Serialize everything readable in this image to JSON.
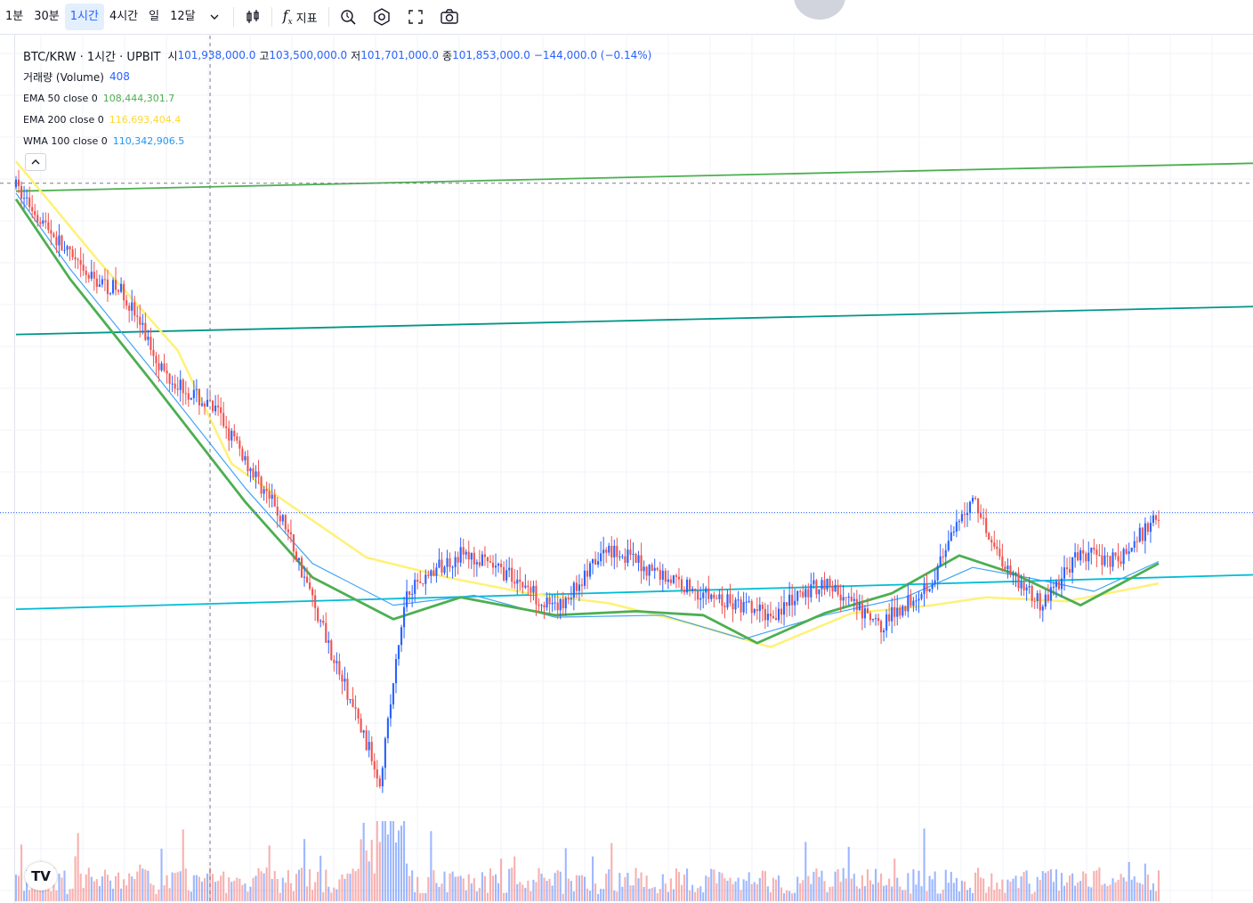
{
  "toolbar": {
    "intervals": [
      {
        "label": "1분",
        "active": false
      },
      {
        "label": "30분",
        "active": false
      },
      {
        "label": "1시간",
        "active": true
      },
      {
        "label": "4시간",
        "active": false
      },
      {
        "label": "일",
        "active": false
      },
      {
        "label": "12달",
        "active": false
      }
    ],
    "indicators_label": "지표",
    "icons": [
      "chevron-down-icon",
      "candle-icon",
      "fx-icon",
      "alert-icon",
      "settings-icon",
      "fullscreen-icon",
      "camera-icon"
    ]
  },
  "legend": {
    "title": "BTC/KRW · 1시간 · UPBIT",
    "open_label": "시",
    "open": "101,938,000.0",
    "high_label": "고",
    "high": "103,500,000.0",
    "low_label": "저",
    "low": "101,701,000.0",
    "close_label": "종",
    "close": "101,853,000.0",
    "change": "−144,000.0 (−0.14%)",
    "volume": {
      "name": "거래량 (Volume)",
      "value": "408",
      "color": "#2962ff"
    },
    "ema50": {
      "name": "EMA 50 close 0",
      "value": "108,444,301.7",
      "color": "#4caf50"
    },
    "ema200": {
      "name": "EMA 200 close 0",
      "value": "116,693,404.4",
      "color": "#ffeb3b"
    },
    "wma100": {
      "name": "WMA 100 close 0",
      "value": "110,342,906.5",
      "color": "#2196f3"
    }
  },
  "colors": {
    "up": "#2962ff",
    "down": "#ef5350",
    "ema50": "#4caf50",
    "ema200": "#fff176",
    "wma100": "#42a5f5",
    "trend_top": "#4caf50",
    "trend_mid": "#009688",
    "trend_low": "#00bcd4"
  },
  "chart_data": {
    "type": "candlestick",
    "symbol": "BTC/KRW",
    "interval": "1시간",
    "exchange": "UPBIT",
    "bars": 425,
    "ylim": [
      86000000,
      120000000
    ],
    "close_path": [
      [
        0,
        118200000
      ],
      [
        10,
        116500000
      ],
      [
        25,
        113800000
      ],
      [
        40,
        112900000
      ],
      [
        55,
        108900000
      ],
      [
        75,
        106800000
      ],
      [
        100,
        101200000
      ],
      [
        120,
        93800000
      ],
      [
        135,
        88500000
      ],
      [
        145,
        98000000
      ],
      [
        165,
        99800000
      ],
      [
        185,
        98600000
      ],
      [
        200,
        96900000
      ],
      [
        220,
        100100000
      ],
      [
        240,
        98700000
      ],
      [
        260,
        97500000
      ],
      [
        280,
        96700000
      ],
      [
        300,
        98400000
      ],
      [
        320,
        96100000
      ],
      [
        340,
        98500000
      ],
      [
        355,
        102700000
      ],
      [
        365,
        99600000
      ],
      [
        380,
        97200000
      ],
      [
        395,
        99800000
      ],
      [
        410,
        99500000
      ],
      [
        424,
        101853000
      ]
    ],
    "ema50_path": [
      [
        0,
        117600000
      ],
      [
        20,
        113600000
      ],
      [
        50,
        108500000
      ],
      [
        85,
        102400000
      ],
      [
        110,
        98600000
      ],
      [
        140,
        96500000
      ],
      [
        165,
        97600000
      ],
      [
        200,
        96700000
      ],
      [
        230,
        96900000
      ],
      [
        255,
        96700000
      ],
      [
        275,
        95300000
      ],
      [
        300,
        96800000
      ],
      [
        325,
        97800000
      ],
      [
        350,
        99700000
      ],
      [
        370,
        98800000
      ],
      [
        395,
        97200000
      ],
      [
        424,
        99300000
      ]
    ],
    "wma100_path": [
      [
        0,
        117900000
      ],
      [
        20,
        114100000
      ],
      [
        50,
        109100000
      ],
      [
        85,
        103100000
      ],
      [
        110,
        99300000
      ],
      [
        140,
        97200000
      ],
      [
        170,
        97700000
      ],
      [
        200,
        96600000
      ],
      [
        240,
        96700000
      ],
      [
        270,
        95500000
      ],
      [
        300,
        96700000
      ],
      [
        330,
        97600000
      ],
      [
        355,
        99100000
      ],
      [
        375,
        98600000
      ],
      [
        400,
        97900000
      ],
      [
        424,
        99400000
      ]
    ],
    "ema200_path": [
      [
        0,
        119500000
      ],
      [
        30,
        114600000
      ],
      [
        60,
        110000000
      ],
      [
        80,
        104300000
      ],
      [
        100,
        102400000
      ],
      [
        130,
        99600000
      ],
      [
        160,
        98600000
      ],
      [
        190,
        97800000
      ],
      [
        220,
        97300000
      ],
      [
        250,
        96300000
      ],
      [
        280,
        95100000
      ],
      [
        310,
        96800000
      ],
      [
        340,
        97200000
      ],
      [
        360,
        97600000
      ],
      [
        390,
        97400000
      ],
      [
        424,
        98300000
      ]
    ],
    "trendlines": [
      {
        "name": "upper channel",
        "color": "#4caf50",
        "from": [
          0,
          118000000
        ],
        "to": [
          425,
          119300000
        ]
      },
      {
        "name": "middle channel",
        "color": "#009688",
        "from": [
          0,
          110800000
        ],
        "to": [
          425,
          112100000
        ]
      },
      {
        "name": "support",
        "color": "#00bcd4",
        "from": [
          0,
          97000000
        ],
        "to": [
          425,
          98600000
        ]
      }
    ],
    "crosshair": {
      "bar": 72,
      "price": 118400000
    },
    "last_price": 101853000
  }
}
